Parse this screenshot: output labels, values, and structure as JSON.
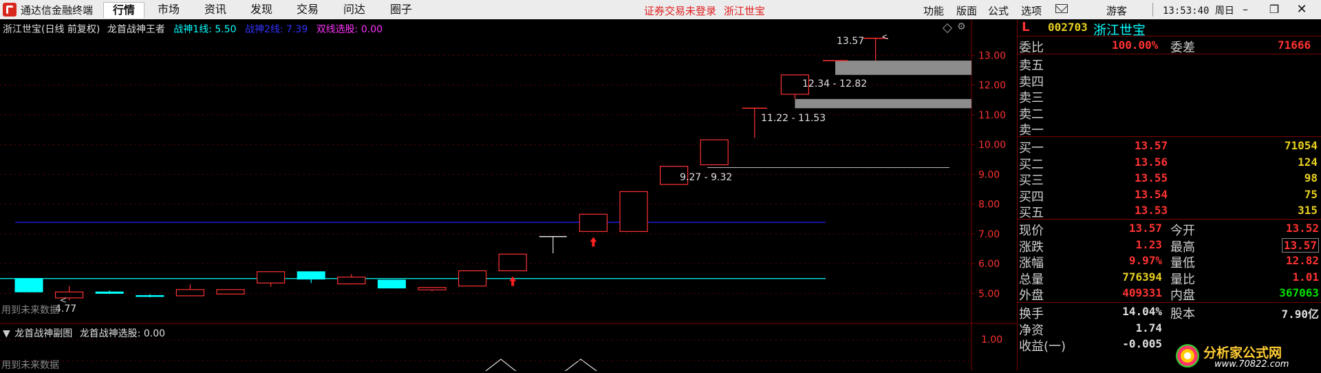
{
  "menubar": {
    "app_name": "通达信金融终端",
    "tabs": [
      "行情",
      "市场",
      "资讯",
      "发现",
      "交易",
      "问达",
      "圈子"
    ],
    "active_tab": "行情",
    "login_warning": "证券交易未登录",
    "stock_name": "浙江世宝",
    "right_menu": [
      "功能",
      "版面",
      "公式",
      "选项"
    ],
    "user": "游客",
    "clock": "13:53:40 周日"
  },
  "chart": {
    "header": {
      "title": "浙江世宝(日线 前复权)",
      "indicator_name": "龙首战神王者",
      "line1": "战神1线: 5.50",
      "line2": "战神2线: 7.39",
      "selection": "双线选股: 0.00"
    },
    "price_axis": [
      "13.00",
      "12.00",
      "11.00",
      "10.00",
      "9.00",
      "8.00",
      "7.00",
      "6.00",
      "5.00"
    ],
    "annotations": {
      "high_label": "13.57",
      "low_label": "4.77",
      "gap1": "12.34 - 12.82",
      "gap2": "11.22 - 11.53",
      "gap3": "9.27 - 9.32",
      "future_data_note": "用到未来数据"
    },
    "sub": {
      "title": "龙首战神副图",
      "selection": "龙首战神选股: 0.00",
      "axis_label": "1.00",
      "future_data_note": "用到未来数据"
    },
    "colors": {
      "up": "#ff3232",
      "down": "#00ffff",
      "line1": "#00ffff",
      "line2": "#2020ff",
      "gap": "#8c8c8c"
    }
  },
  "chart_data": {
    "type": "candlestick",
    "title": "浙江世宝(日线 前复权)",
    "ylim": [
      4.5,
      13.7
    ],
    "candles": [
      {
        "open": 5.5,
        "close": 5.05,
        "high": 5.5,
        "low": 5.05
      },
      {
        "open": 4.85,
        "close": 5.05,
        "high": 5.25,
        "low": 4.77
      },
      {
        "open": 5.05,
        "close": 5.0,
        "high": 5.1,
        "low": 4.98
      },
      {
        "open": 4.93,
        "close": 4.9,
        "high": 4.97,
        "low": 4.87
      },
      {
        "open": 4.92,
        "close": 5.13,
        "high": 5.3,
        "low": 4.92
      },
      {
        "open": 4.98,
        "close": 5.13,
        "high": 5.13,
        "low": 4.98
      },
      {
        "open": 5.35,
        "close": 5.73,
        "high": 5.73,
        "low": 5.22
      },
      {
        "open": 5.73,
        "close": 5.48,
        "high": 5.73,
        "low": 5.35
      },
      {
        "open": 5.32,
        "close": 5.55,
        "high": 5.65,
        "low": 5.3
      },
      {
        "open": 5.45,
        "close": 5.18,
        "high": 5.45,
        "low": 5.18
      },
      {
        "open": 5.12,
        "close": 5.2,
        "high": 5.22,
        "low": 5.07
      },
      {
        "open": 5.25,
        "close": 5.76,
        "high": 5.76,
        "low": 5.25
      },
      {
        "open": 5.76,
        "close": 6.32,
        "high": 6.32,
        "low": 5.76
      },
      {
        "open": 6.91,
        "close": 6.91,
        "high": 6.91,
        "low": 6.35
      },
      {
        "open": 7.08,
        "close": 7.66,
        "high": 7.66,
        "low": 7.08
      },
      {
        "open": 7.08,
        "close": 8.42,
        "high": 8.42,
        "low": 7.08
      },
      {
        "open": 8.66,
        "close": 9.27,
        "high": 9.27,
        "low": 8.66
      },
      {
        "open": 9.32,
        "close": 10.16,
        "high": 10.16,
        "low": 9.32
      },
      {
        "open": 11.22,
        "close": 11.22,
        "high": 11.22,
        "low": 10.22
      },
      {
        "open": 11.69,
        "close": 12.34,
        "high": 12.34,
        "low": 11.53
      },
      {
        "open": 12.82,
        "close": 12.82,
        "high": 12.82,
        "low": 12.82
      },
      {
        "open": 13.57,
        "close": 13.57,
        "high": 13.57,
        "low": 12.82
      }
    ],
    "hlines": [
      {
        "name": "战神1线",
        "value": 5.5
      },
      {
        "name": "战神2线",
        "value": 7.39
      }
    ],
    "gaps": [
      {
        "from_index": 20,
        "low": 12.34,
        "high": 12.82
      },
      {
        "from_index": 19,
        "low": 11.22,
        "high": 11.53
      },
      {
        "from_index": 17,
        "low": 9.27,
        "high": 9.32
      }
    ],
    "signal_arrows": [
      12,
      14
    ]
  },
  "quote": {
    "code": "002703",
    "name": "浙江世宝",
    "flag": "L",
    "ratio_label": "委比",
    "ratio_value": "100.00%",
    "diff_label": "委差",
    "diff_value": "71666",
    "sell": [
      {
        "label": "卖五",
        "price": "",
        "vol": ""
      },
      {
        "label": "卖四",
        "price": "",
        "vol": ""
      },
      {
        "label": "卖三",
        "price": "",
        "vol": ""
      },
      {
        "label": "卖二",
        "price": "",
        "vol": ""
      },
      {
        "label": "卖一",
        "price": "",
        "vol": ""
      }
    ],
    "buy": [
      {
        "label": "买一",
        "price": "13.57",
        "vol": "71054"
      },
      {
        "label": "买二",
        "price": "13.56",
        "vol": "124"
      },
      {
        "label": "买三",
        "price": "13.55",
        "vol": "98"
      },
      {
        "label": "买四",
        "price": "13.54",
        "vol": "75"
      },
      {
        "label": "买五",
        "price": "13.53",
        "vol": "315"
      }
    ],
    "stats": [
      {
        "l1": "现价",
        "v1": "13.57",
        "l2": "今开",
        "v2": "13.52"
      },
      {
        "l1": "涨跌",
        "v1": "1.23",
        "l2": "最高",
        "v2": "13.57"
      },
      {
        "l1": "涨幅",
        "v1": "9.97%",
        "l2": "量低",
        "v2": "12.82"
      },
      {
        "l1": "总量",
        "v1": "776394",
        "l2": "量比",
        "v2": "1.01"
      },
      {
        "l1": "外盘",
        "v1": "409331",
        "l2": "内盘",
        "v2": "367063"
      }
    ],
    "extra": [
      {
        "l1": "换手",
        "v1": "14.04%",
        "l2": "股本",
        "v2": "7.90亿"
      },
      {
        "l1": "净资",
        "v1": "1.74",
        "l2": "",
        "v2": ""
      },
      {
        "l1": "收益(一)",
        "v1": "-0.005",
        "l2": "",
        "v2": ""
      }
    ],
    "watermark_text": "分析家公式网",
    "watermark_url": "www.70822.com"
  }
}
